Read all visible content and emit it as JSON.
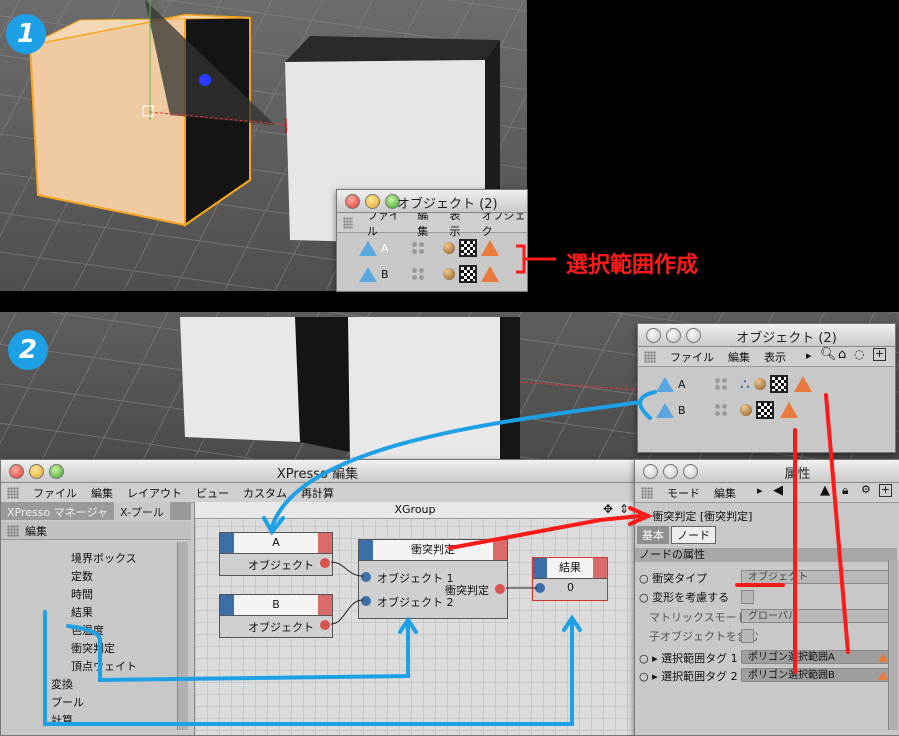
{
  "step_labels": [
    "1",
    "2"
  ],
  "annotation": "選択範囲作成",
  "object_manager_1": {
    "title": "オブジェクト (2)",
    "menu": [
      "ファイル",
      "編集",
      "表示",
      "オブジェク"
    ],
    "objects": [
      "A",
      "B"
    ]
  },
  "object_manager_2": {
    "title": "オブジェクト (2)",
    "menu": [
      "ファイル",
      "編集",
      "表示"
    ],
    "objects": [
      "A",
      "B"
    ]
  },
  "xpresso": {
    "title": "XPresso 編集",
    "menu": [
      "ファイル",
      "編集",
      "レイアウト",
      "ビュー",
      "カスタム",
      "再計算"
    ],
    "tabs": [
      "XPresso マネージャ",
      "X-プール"
    ],
    "pool_header": "編集",
    "tree_items": [
      "境界ボックス",
      "定数",
      "時間",
      "結果",
      "色温度",
      "衝突判定",
      "頂点ウェイト",
      "変換",
      "プール",
      "計算"
    ],
    "canvas_title": "XGroup",
    "nodes": {
      "a": {
        "title": "A",
        "port": "オブジェクト"
      },
      "b": {
        "title": "B",
        "port": "オブジェクト"
      },
      "collision": {
        "title": "衝突判定",
        "in1": "オブジェクト 1",
        "in2": "オブジェクト 2",
        "out": "衝突判定"
      },
      "result": {
        "title": "結果",
        "value": "0"
      }
    }
  },
  "attributes": {
    "title": "属性",
    "menu": [
      "モード",
      "編集"
    ],
    "node_label": "衝突判定 [衝突判定]",
    "tabs": [
      "基本",
      "ノード"
    ],
    "section": "ノードの属性",
    "fields": [
      {
        "label": "衝突タイプ",
        "value": "オブジェクト"
      },
      {
        "label": "変形を考慮する",
        "value": ""
      },
      {
        "label": "マトリックスモード",
        "value": "グローバル"
      },
      {
        "label": "子オブジェクトを含む",
        "value": ""
      },
      {
        "label": "選択範囲タグ 1",
        "value": "ポリゴン選択範囲A"
      },
      {
        "label": "選択範囲タグ 2",
        "value": "ポリゴン選択範囲B"
      }
    ]
  },
  "colors": {
    "accent_blue": "#1ea0e6",
    "annotation_red": "#ff1a1a",
    "node_blue": "#3c6ea8",
    "node_red": "#d96b6b"
  }
}
